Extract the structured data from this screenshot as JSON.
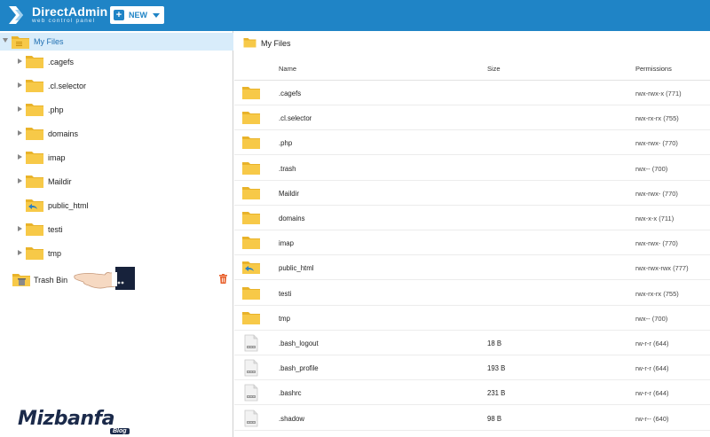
{
  "app": {
    "title": "DirectAdmin",
    "subtitle": "web control panel",
    "new_button_label": "NEW"
  },
  "tree": {
    "root_label": "My Files",
    "items": [
      {
        "label": ".cagefs",
        "expandable": true,
        "icon": "folder-icon"
      },
      {
        "label": ".cl.selector",
        "expandable": true,
        "icon": "folder-icon"
      },
      {
        "label": ".php",
        "expandable": true,
        "icon": "folder-icon"
      },
      {
        "label": "domains",
        "expandable": true,
        "icon": "folder-icon"
      },
      {
        "label": "imap",
        "expandable": true,
        "icon": "folder-icon"
      },
      {
        "label": "Maildir",
        "expandable": true,
        "icon": "folder-icon"
      },
      {
        "label": "public_html",
        "expandable": false,
        "icon": "folder-link-icon"
      },
      {
        "label": "testi",
        "expandable": true,
        "icon": "folder-icon"
      },
      {
        "label": "tmp",
        "expandable": true,
        "icon": "folder-icon"
      }
    ],
    "trash_label": "Trash Bin"
  },
  "main": {
    "breadcrumb": "My Files",
    "columns": {
      "name": "Name",
      "size": "Size",
      "permissions": "Permissions"
    },
    "rows": [
      {
        "icon": "folder-icon",
        "name": ".cagefs",
        "size": "",
        "permissions": "rwx-rwx-x (771)"
      },
      {
        "icon": "folder-icon",
        "name": ".cl.selector",
        "size": "",
        "permissions": "rwx-rx-rx (755)"
      },
      {
        "icon": "folder-icon",
        "name": ".php",
        "size": "",
        "permissions": "rwx-rwx- (770)"
      },
      {
        "icon": "folder-icon",
        "name": ".trash",
        "size": "",
        "permissions": "rwx-- (700)"
      },
      {
        "icon": "folder-icon",
        "name": "Maildir",
        "size": "",
        "permissions": "rwx-rwx- (770)"
      },
      {
        "icon": "folder-icon",
        "name": "domains",
        "size": "",
        "permissions": "rwx-x-x (711)"
      },
      {
        "icon": "folder-icon",
        "name": "imap",
        "size": "",
        "permissions": "rwx-rwx- (770)"
      },
      {
        "icon": "folder-link-icon",
        "name": "public_html",
        "size": "",
        "permissions": "rwx-rwx-rwx (777)"
      },
      {
        "icon": "folder-icon",
        "name": "testi",
        "size": "",
        "permissions": "rwx-rx-rx (755)"
      },
      {
        "icon": "folder-icon",
        "name": "tmp",
        "size": "",
        "permissions": "rwx-- (700)"
      },
      {
        "icon": "file-icon",
        "name": ".bash_logout",
        "size": "18 B",
        "permissions": "rw-r-r (644)"
      },
      {
        "icon": "file-icon",
        "name": ".bash_profile",
        "size": "193 B",
        "permissions": "rw-r-r (644)"
      },
      {
        "icon": "file-icon",
        "name": ".bashrc",
        "size": "231 B",
        "permissions": "rw-r-r (644)"
      },
      {
        "icon": "file-icon",
        "name": ".shadow",
        "size": "98 B",
        "permissions": "rw-r-- (640)"
      }
    ]
  },
  "watermark": {
    "brand": "Mizbanfa",
    "tag": "Blog"
  },
  "colors": {
    "header": "#1f84c6",
    "selected_row": "#d8ecfa",
    "folder": "#f7c948",
    "trash_delete": "#e8602c"
  }
}
